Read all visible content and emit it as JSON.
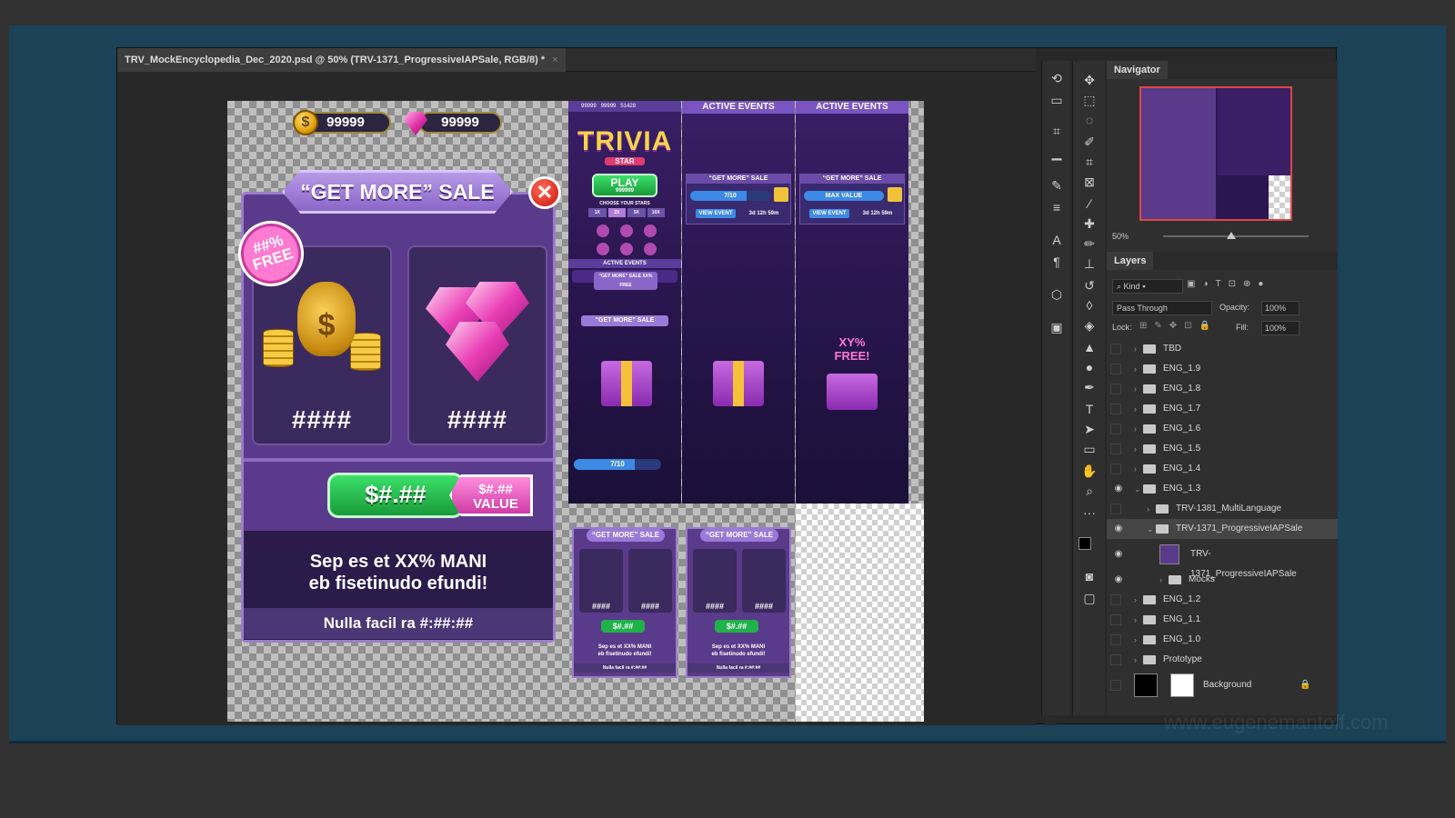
{
  "document_tab": {
    "title": "TRV_MockEncyclopedia_Dec_2020.psd @ 50% (TRV-1371_ProgressiveIAPSale, RGB/8) *",
    "close": "×"
  },
  "mock_main": {
    "coins": "99999",
    "gems": "99999",
    "coin_symbol": "$",
    "banner": "“GET MORE” SALE",
    "close": "✕",
    "burst": "##%\nFREE",
    "card1_amount": "####",
    "card2_amount": "####",
    "price": "$#.##",
    "value_tag": "$#.##\nVALUE",
    "info_line1": "Sep es et XX% MANI",
    "info_line2": "eb fisetinudo efundi!",
    "footer": "Nulla facil ra #:##:##"
  },
  "mock_trivia": {
    "top_coins": "99999",
    "top_gems": "99999",
    "top_stars": "51428",
    "logo": "TRIVIA",
    "logo_sub": "STAR",
    "play": "PLAY",
    "play_cost": "999999",
    "choose_stars": "CHOOSE YOUR STARS",
    "multipliers": [
      "1X",
      "2X",
      "5X",
      "10X"
    ],
    "modes": [
      "QUESTION OF THE DAY",
      "5/4B",
      "EXPERT",
      "LEAGUE",
      "???",
      "POINTS PLAY"
    ],
    "active_events": "ACTIVE EVENTS",
    "event_banner": "“GET MORE” SALE XX% FREE"
  },
  "mock_events": [
    {
      "header": "ACTIVE EVENTS",
      "title": "“GET MORE” SALE",
      "progress": "7/10",
      "progress_fraction": 0.7,
      "view": "VIEW EVENT",
      "timer": "3d 12h 59m"
    },
    {
      "header": "ACTIVE EVENTS",
      "title": "“GET MORE” SALE",
      "progress": "MAX VALUE",
      "progress_fraction": 1.0,
      "view": "VIEW EVENT",
      "timer": "3d 12h 59m"
    }
  ],
  "mock_gifts": {
    "title": "“GET MORE” SALE",
    "progress": "7/10",
    "progress_fraction": 0.7,
    "free": "XY%\nFREE!"
  },
  "mock_small": [
    {
      "coins": "99999",
      "gems": "99999",
      "banner": "“GET MORE” SALE",
      "burst": "##%\nFREE",
      "a1": "####",
      "a2": "####",
      "price": "$#.##",
      "value": "$#.##\nVALUE",
      "l1": "Sep es et XX% MANI",
      "l2": "eb fisetinudo efundi!",
      "footer": "Nulla facil ra #:##:##"
    },
    {
      "coins": "99999",
      "gems": "99999",
      "banner": "“GET MORE” SALE",
      "burst": "##%\nFREE",
      "a1": "####",
      "a2": "####",
      "price": "$#.##",
      "value": "$#.##\nVALUE",
      "l1": "Sep es et XX% MANI",
      "l2": "eb fisetinudo efundi!",
      "footer": "Nulla facil ra #:##:##"
    }
  ],
  "navigator": {
    "title": "Navigator",
    "zoom": "50%"
  },
  "layers": {
    "title": "Layers",
    "kind": "Kind",
    "blend": "Pass Through",
    "opacity_label": "Opacity:",
    "opacity": "100%",
    "lock_label": "Lock:",
    "fill_label": "Fill:",
    "fill": "100%",
    "items": [
      {
        "name": "TBD",
        "visible": false
      },
      {
        "name": "ENG_1.9",
        "visible": false
      },
      {
        "name": "ENG_1.8",
        "visible": false
      },
      {
        "name": "ENG_1.7",
        "visible": false
      },
      {
        "name": "ENG_1.6",
        "visible": false
      },
      {
        "name": "ENG_1.5",
        "visible": false
      },
      {
        "name": "ENG_1.4",
        "visible": false
      },
      {
        "name": "ENG_1.3",
        "visible": true
      },
      {
        "name": "TRV-1381_MultiLanguage",
        "visible": false
      },
      {
        "name": "TRV-1371_ProgressiveIAPSale",
        "visible": true
      },
      {
        "name": "TRV-1371_ProgressiveIAPSale",
        "visible": true
      },
      {
        "name": "Mocks",
        "visible": true
      },
      {
        "name": "ENG_1.2",
        "visible": false
      },
      {
        "name": "ENG_1.1",
        "visible": false
      },
      {
        "name": "ENG_1.0",
        "visible": false
      },
      {
        "name": "Prototype",
        "visible": false
      },
      {
        "name": "Background",
        "visible": false
      }
    ]
  },
  "tools": [
    "move-icon",
    "marquee-icon",
    "lasso-icon",
    "quick-select-icon",
    "crop-icon",
    "frame-icon",
    "eyedropper-icon",
    "healing-icon",
    "brush-icon",
    "stamp-icon",
    "history-brush-icon",
    "eraser-icon",
    "paint-bucket-icon",
    "blur-icon",
    "dodge-icon",
    "pen-icon",
    "type-icon",
    "path-select-icon",
    "rectangle-icon",
    "hand-icon",
    "zoom-icon",
    "more-icon"
  ],
  "watermark": "www.eugenemantoff.com"
}
